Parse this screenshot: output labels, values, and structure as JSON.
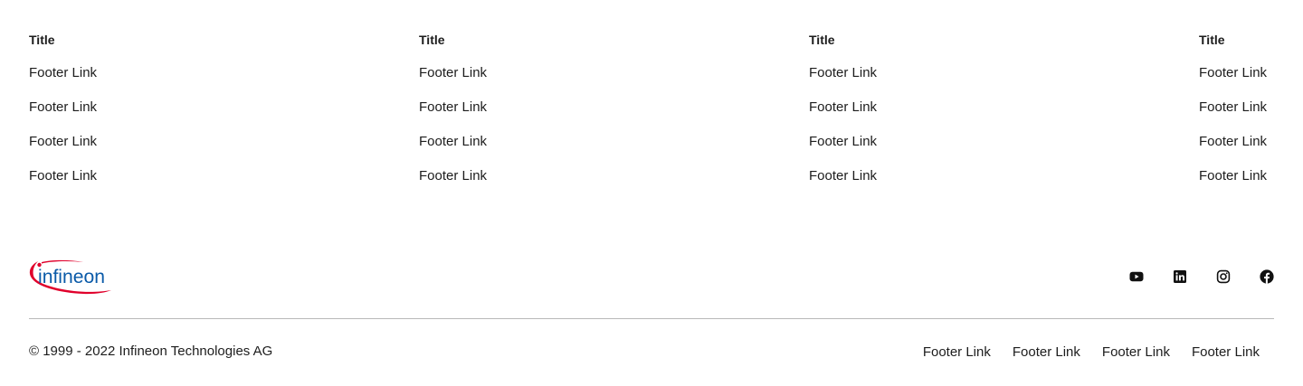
{
  "columns": [
    {
      "title": "Title",
      "links": [
        "Footer Link",
        "Footer Link",
        "Footer Link",
        "Footer Link"
      ]
    },
    {
      "title": "Title",
      "links": [
        "Footer Link",
        "Footer Link",
        "Footer Link",
        "Footer Link"
      ]
    },
    {
      "title": "Title",
      "links": [
        "Footer Link",
        "Footer Link",
        "Footer Link",
        "Footer Link"
      ]
    },
    {
      "title": "Title",
      "links": [
        "Footer Link",
        "Footer Link",
        "Footer Link",
        "Footer Link"
      ]
    }
  ],
  "brand": {
    "logo_text": "infineon",
    "logo_text_color": "#0a5aa8",
    "logo_swoosh_color": "#e0002b"
  },
  "socials": [
    {
      "icon": "youtube-icon"
    },
    {
      "icon": "linkedin-icon"
    },
    {
      "icon": "instagram-icon"
    },
    {
      "icon": "facebook-icon"
    }
  ],
  "bottom": {
    "copyright": "© 1999 - 2022 Infineon Technologies AG",
    "links": [
      "Footer Link",
      "Footer Link",
      "Footer Link",
      "Footer Link"
    ]
  }
}
